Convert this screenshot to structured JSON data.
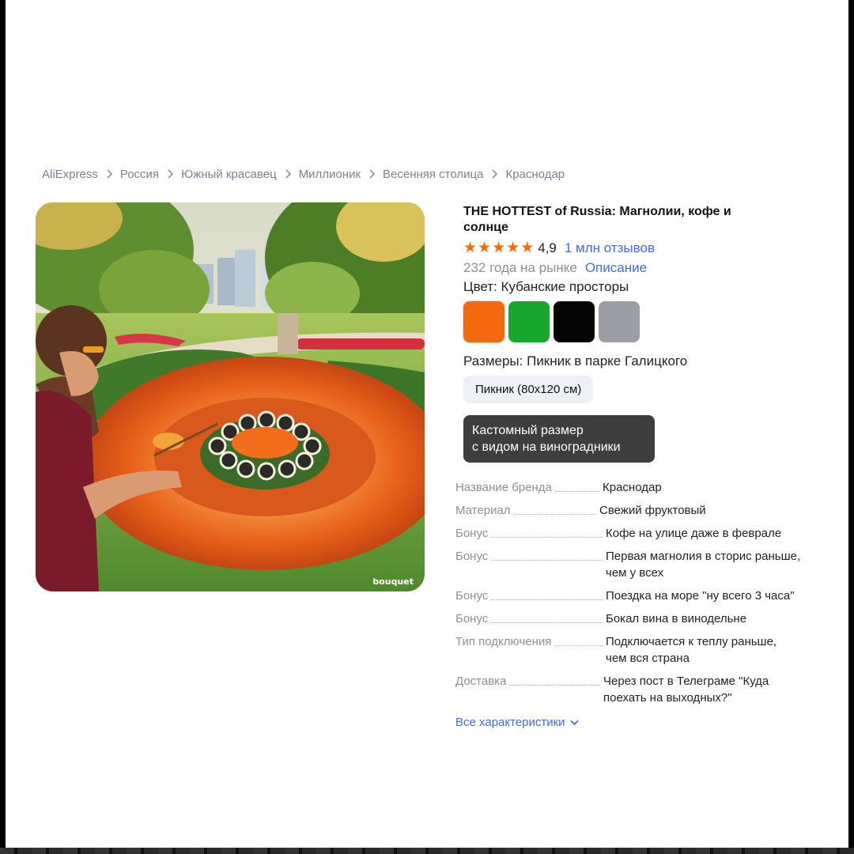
{
  "breadcrumb": [
    "AliExpress",
    "Россия",
    "Южный красавец",
    "Миллионик",
    "Весенняя столица",
    "Краснодар"
  ],
  "image": {
    "watermark": "bouquet"
  },
  "product": {
    "title": "THE HOTTEST of Russia: Магнолии, кофе и солнце",
    "rating": "4,9",
    "stars_filled": 5,
    "reviews": "1 млн отзывов",
    "years": "232 года на рынке",
    "description_link": "Описание",
    "color_label": "Цвет: Кубанские просторы",
    "swatches": [
      {
        "name": "orange",
        "color": "#f36a0e",
        "selected": true
      },
      {
        "name": "green",
        "color": "#16a82e",
        "selected": false
      },
      {
        "name": "black",
        "color": "#050505",
        "selected": false
      },
      {
        "name": "gray",
        "color": "#9c9ea6",
        "selected": false
      }
    ],
    "size_label": "Размеры: Пикник в парке Галицкого",
    "size_option": "Пикник (80x120 см)",
    "custom_size_line1": "Кастомный размер",
    "custom_size_line2": "с видом на виноградники"
  },
  "specs": [
    {
      "key": "Название бренда",
      "value": "Краснодар"
    },
    {
      "key": "Материал",
      "value": "Свежий фруктовый"
    },
    {
      "key": "Бонус",
      "value": "Кофе на улице даже в феврале"
    },
    {
      "key": "Бонус",
      "value": "Первая магнолия в сторис раньше, чем у всех"
    },
    {
      "key": "Бонус",
      "value": "Поездка на море \"ну всего 3 часа\""
    },
    {
      "key": "Бонус",
      "value": "Бокал вина в винодельне"
    },
    {
      "key": "Тип подключения",
      "value": "Подключается к теплу раньше, чем вся страна"
    },
    {
      "key": "Доставка",
      "value": "Через пост в Телеграме \"Куда поехать на выходных?\""
    }
  ],
  "all_specs_link": "Все характеристики"
}
